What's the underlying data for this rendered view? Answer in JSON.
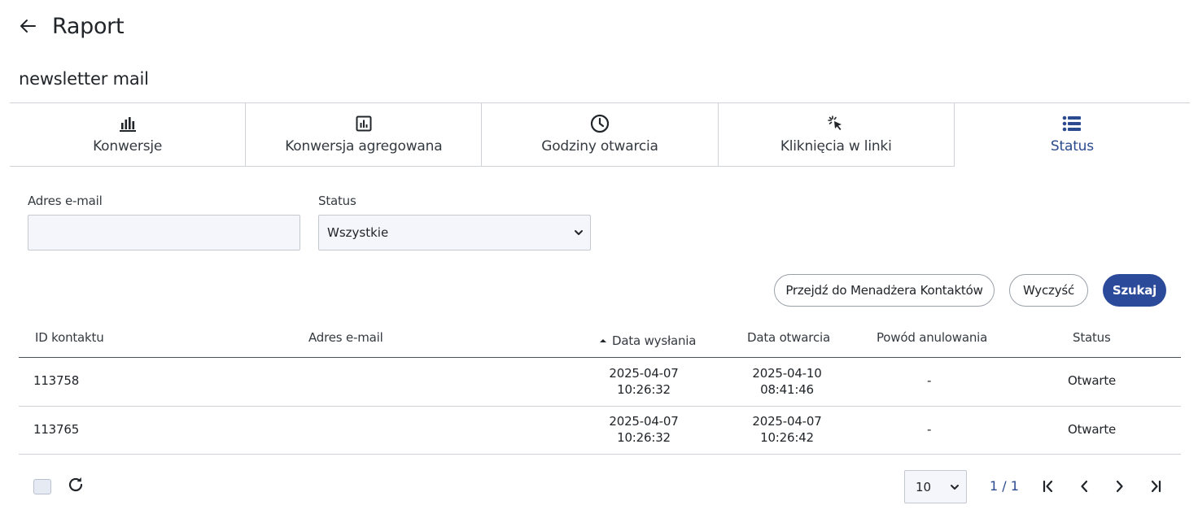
{
  "header": {
    "title": "Raport",
    "back_icon": "arrow-left-icon"
  },
  "report": {
    "name": "newsletter mail"
  },
  "tabs": [
    {
      "label": "Konwersje",
      "icon": "bar-chart-icon",
      "active": false
    },
    {
      "label": "Konwersja agregowana",
      "icon": "chart-box-icon",
      "active": false
    },
    {
      "label": "Godziny otwarcia",
      "icon": "clock-icon",
      "active": false
    },
    {
      "label": "Kliknięcia w linki",
      "icon": "cursor-click-icon",
      "active": false
    },
    {
      "label": "Status",
      "icon": "list-icon",
      "active": true
    }
  ],
  "filters": {
    "email_label": "Adres e-mail",
    "email_value": "",
    "status_label": "Status",
    "status_value": "Wszystkie"
  },
  "actions": {
    "contacts_manager": "Przejdź do Menadżera Kontaktów",
    "clear": "Wyczyść",
    "search": "Szukaj"
  },
  "table": {
    "columns": [
      "ID kontaktu",
      "Adres e-mail",
      "Data wysłania",
      "Data otwarcia",
      "Powód anulowania",
      "Status"
    ],
    "sorted_column": "Data wysłania",
    "sort_direction": "ascending",
    "rows": [
      {
        "id": "113758",
        "email": "",
        "sent_date": "2025-04-07",
        "sent_time": "10:26:32",
        "open_date": "2025-04-10",
        "open_time": "08:41:46",
        "cancel_reason": "-",
        "status": "Otwarte"
      },
      {
        "id": "113765",
        "email": "",
        "sent_date": "2025-04-07",
        "sent_time": "10:26:32",
        "open_date": "2025-04-07",
        "open_time": "10:26:42",
        "cancel_reason": "-",
        "status": "Otwarte"
      }
    ]
  },
  "pagination": {
    "page_size": "10",
    "page_info": "1 / 1"
  },
  "colors": {
    "primary": "#2c4a9a",
    "active_tab": "#2c4a8f",
    "input_bg": "#f4f6fb",
    "border": "#cfd2d6"
  }
}
